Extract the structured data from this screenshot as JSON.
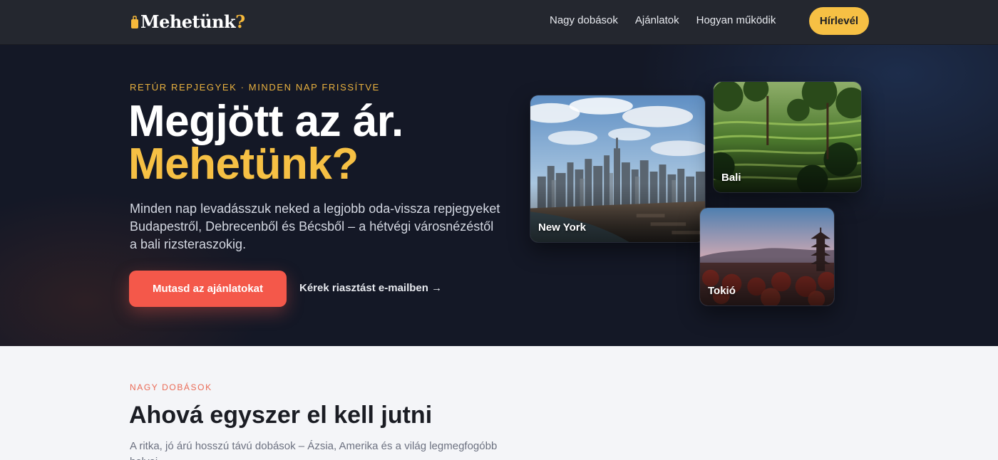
{
  "header": {
    "logo_text": "Mehetünk",
    "logo_q": "?",
    "nav": [
      {
        "label": "Nagy dobások"
      },
      {
        "label": "Ajánlatok"
      },
      {
        "label": "Hogyan működik"
      }
    ],
    "newsletter_label": "Hírlevél"
  },
  "hero": {
    "eyebrow": "RETÚR REPJEGYEK · MINDEN NAP FRISSÍTVE",
    "title_line1": "Megjött az ár.",
    "title_line2": "Mehetünk?",
    "lead": "Minden nap levadásszuk neked a legjobb oda-vissza repjegyeket Budapestről, Debrecenből és Bécsből – a hétvégi városnézéstől a bali rizsteraszokig.",
    "cta_label": "Mutasd az ajánlatokat",
    "alert_label": "Kérek riasztást e-mailben →",
    "cards": [
      {
        "label": "New York"
      },
      {
        "label": "Bali"
      },
      {
        "label": "Tokió"
      }
    ]
  },
  "section": {
    "eyebrow": "NAGY DOBÁSOK",
    "title": "Ahová egyszer el kell jutni",
    "description": "A ritka, jó árú hosszú távú dobások – Ázsia, Amerika és a világ legmegfogóbb helyei."
  },
  "colors": {
    "accent_yellow": "#f6c044",
    "cta_red": "#f4584a",
    "header_bg": "#24272f",
    "hero_bg": "#141826"
  }
}
